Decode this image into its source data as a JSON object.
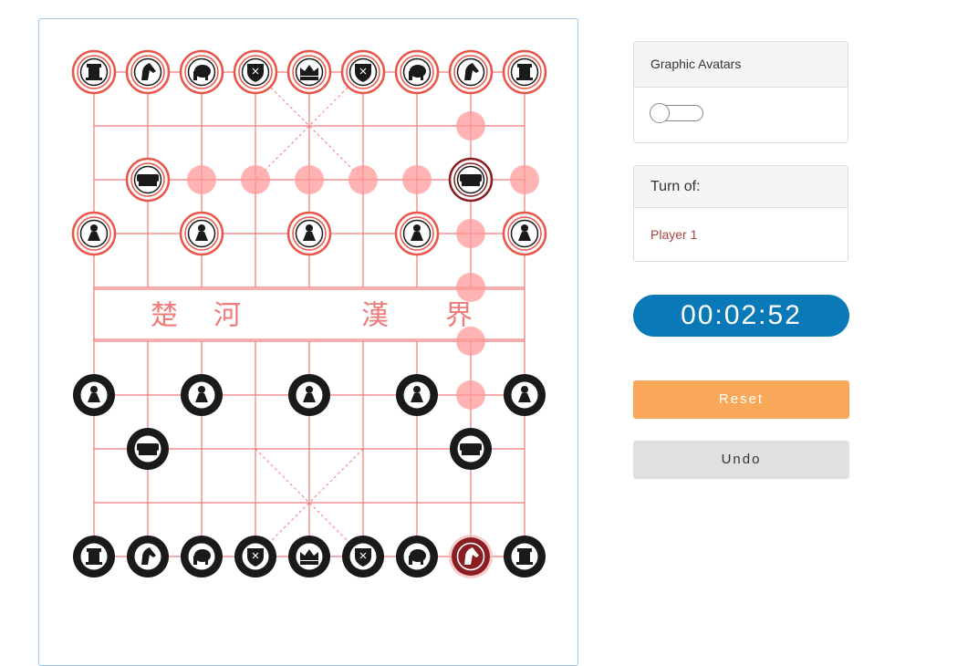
{
  "settings": {
    "avatars_label": "Graphic Avatars",
    "avatars_enabled": false
  },
  "turn": {
    "label": "Turn of:",
    "player": "Player 1"
  },
  "timer": "00:02:52",
  "buttons": {
    "reset": "Reset",
    "undo": "Undo"
  },
  "river": {
    "chars": [
      "楚",
      "河",
      "漢",
      "界"
    ]
  },
  "colors": {
    "line": "#f07a7a",
    "red_ring": "#e8564a",
    "hint": "#ff9a9a",
    "selected": "#8b1e22",
    "black": "#1a1a1a"
  },
  "pieces": [
    {
      "side": "red",
      "type": "rook",
      "col": 0,
      "row": 0
    },
    {
      "side": "red",
      "type": "knight",
      "col": 1,
      "row": 0
    },
    {
      "side": "red",
      "type": "elephant",
      "col": 2,
      "row": 0
    },
    {
      "side": "red",
      "type": "advisor",
      "col": 3,
      "row": 0
    },
    {
      "side": "red",
      "type": "king",
      "col": 4,
      "row": 0
    },
    {
      "side": "red",
      "type": "advisor",
      "col": 5,
      "row": 0
    },
    {
      "side": "red",
      "type": "elephant",
      "col": 6,
      "row": 0
    },
    {
      "side": "red",
      "type": "knight",
      "col": 7,
      "row": 0
    },
    {
      "side": "red",
      "type": "rook",
      "col": 8,
      "row": 0
    },
    {
      "side": "red",
      "type": "cannon",
      "col": 1,
      "row": 2
    },
    {
      "side": "red",
      "type": "cannon",
      "col": 7,
      "row": 2,
      "state": "targeted"
    },
    {
      "side": "red",
      "type": "pawn",
      "col": 0,
      "row": 3
    },
    {
      "side": "red",
      "type": "pawn",
      "col": 2,
      "row": 3
    },
    {
      "side": "red",
      "type": "pawn",
      "col": 4,
      "row": 3
    },
    {
      "side": "red",
      "type": "pawn",
      "col": 6,
      "row": 3
    },
    {
      "side": "red",
      "type": "pawn",
      "col": 8,
      "row": 3
    },
    {
      "side": "black",
      "type": "pawn",
      "col": 0,
      "row": 6
    },
    {
      "side": "black",
      "type": "pawn",
      "col": 2,
      "row": 6
    },
    {
      "side": "black",
      "type": "pawn",
      "col": 4,
      "row": 6
    },
    {
      "side": "black",
      "type": "pawn",
      "col": 6,
      "row": 6
    },
    {
      "side": "black",
      "type": "pawn",
      "col": 8,
      "row": 6
    },
    {
      "side": "black",
      "type": "cannon",
      "col": 1,
      "row": 7
    },
    {
      "side": "black",
      "type": "cannon",
      "col": 7,
      "row": 7
    },
    {
      "side": "black",
      "type": "rook",
      "col": 0,
      "row": 9
    },
    {
      "side": "black",
      "type": "knight",
      "col": 1,
      "row": 9
    },
    {
      "side": "black",
      "type": "elephant",
      "col": 2,
      "row": 9
    },
    {
      "side": "black",
      "type": "advisor",
      "col": 3,
      "row": 9
    },
    {
      "side": "black",
      "type": "king",
      "col": 4,
      "row": 9
    },
    {
      "side": "black",
      "type": "advisor",
      "col": 5,
      "row": 9
    },
    {
      "side": "black",
      "type": "elephant",
      "col": 6,
      "row": 9
    },
    {
      "side": "black",
      "type": "knight",
      "col": 7,
      "row": 9,
      "state": "selected"
    },
    {
      "side": "black",
      "type": "rook",
      "col": 8,
      "row": 9
    }
  ],
  "move_hints": [
    {
      "col": 7,
      "row": 1
    },
    {
      "col": 2,
      "row": 2
    },
    {
      "col": 3,
      "row": 2
    },
    {
      "col": 4,
      "row": 2
    },
    {
      "col": 5,
      "row": 2
    },
    {
      "col": 6,
      "row": 2
    },
    {
      "col": 8,
      "row": 2
    },
    {
      "col": 7,
      "row": 3
    },
    {
      "col": 7,
      "row": 4
    },
    {
      "col": 7,
      "row": 5
    },
    {
      "col": 7,
      "row": 6
    }
  ]
}
